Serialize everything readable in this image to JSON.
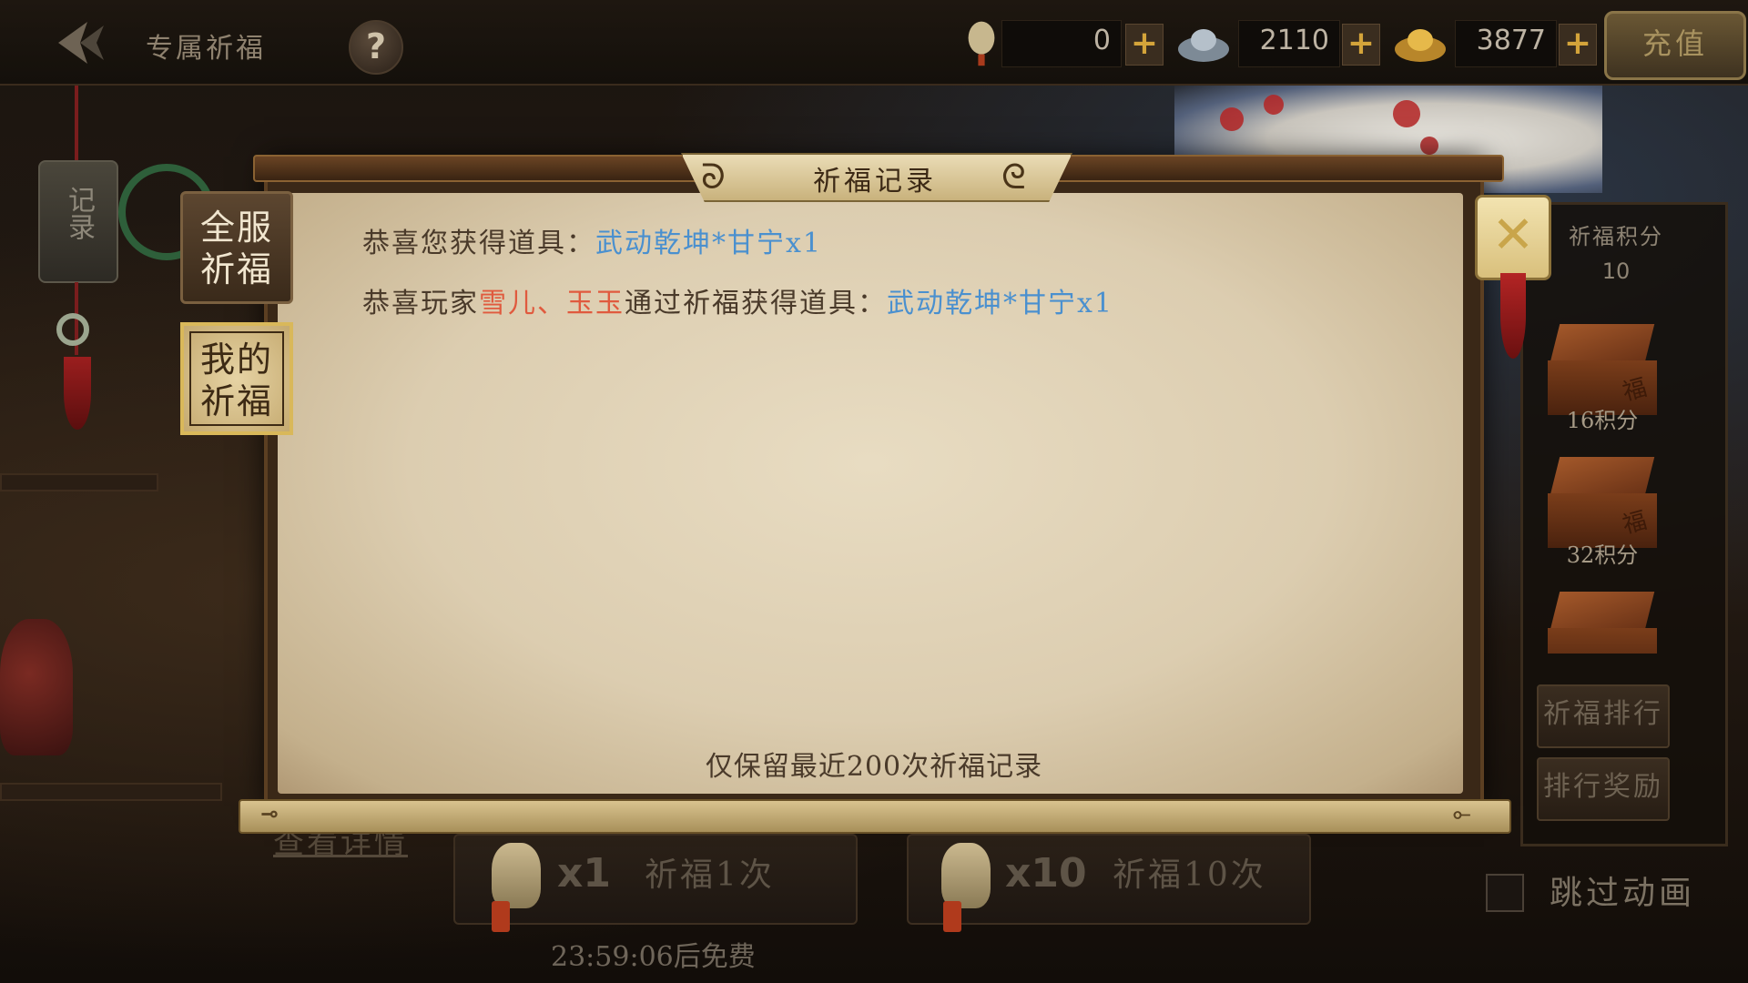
{
  "topbar": {
    "title": "专属祈福",
    "help_icon": "question-icon",
    "currencies": [
      {
        "icon": "lantern-icon",
        "value": "0"
      },
      {
        "icon": "silver-ingot-icon",
        "value": "2110"
      },
      {
        "icon": "gold-ingot-icon",
        "value": "3877"
      }
    ],
    "recharge_label": "充值"
  },
  "left": {
    "record_tab_label": "记录"
  },
  "modal": {
    "title": "祈福记录",
    "tabs": [
      {
        "label_line1": "全服",
        "label_line2": "祈福"
      },
      {
        "label_line1": "我的",
        "label_line2": "祈福"
      }
    ],
    "entries": [
      {
        "prefix": "恭喜您获得道具：",
        "item": "武动乾坤*甘宁x1"
      },
      {
        "prefix": "恭喜玩家",
        "player": "雪儿、玉玉",
        "middle": "通过祈福获得道具：",
        "item": "武动乾坤*甘宁x1"
      }
    ],
    "footer_note": "仅保留最近200次祈福记录",
    "close_icon": "close-icon"
  },
  "right_panel": {
    "points_title": "祈福积分",
    "points_value": "10",
    "chests": [
      {
        "label": "16积分",
        "mark": "福"
      },
      {
        "label": "32积分",
        "mark": "福"
      },
      {
        "label": "",
        "mark": ""
      }
    ],
    "ranking_label": "祈福排行",
    "reward_label": "排行奖励"
  },
  "bottom": {
    "details_label": "查看详情",
    "pray_once": {
      "mult": "x1",
      "label": "祈福1次"
    },
    "pray_ten": {
      "mult": "x10",
      "label": "祈福10次"
    },
    "free_timer": "23:59:06后免费",
    "skip_label": "跳过动画"
  },
  "colors": {
    "item_blue": "#4a90cf",
    "player_red": "#e05a3e",
    "parchment": "#e8dcc2",
    "gold_accent": "#d4a43a"
  }
}
